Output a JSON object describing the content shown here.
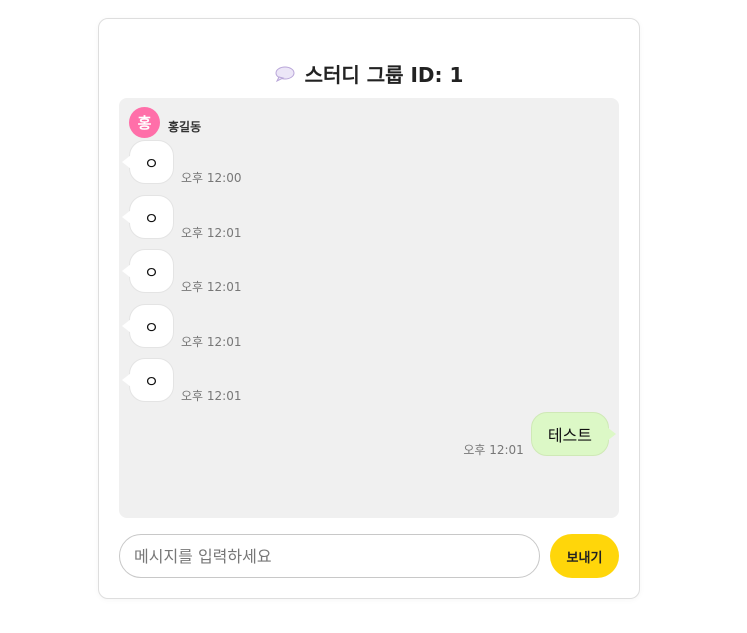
{
  "header": {
    "title": "스터디 그룹 ID: 1",
    "icon": "speech-bubble-icon"
  },
  "sender": {
    "avatar_initial": "홍",
    "name": "홍길동",
    "avatar_color": "#ff6fa9"
  },
  "messages": [
    {
      "text": "ㅇ",
      "time": "오후 12:00"
    },
    {
      "text": "ㅇ",
      "time": "오후 12:01"
    },
    {
      "text": "ㅇ",
      "time": "오후 12:01"
    },
    {
      "text": "ㅇ",
      "time": "오후 12:01"
    },
    {
      "text": "ㅇ",
      "time": "오후 12:01"
    }
  ],
  "my_message": {
    "text": "테스트",
    "time": "오후 12:01",
    "bubble_color": "#dcf8c6"
  },
  "composer": {
    "placeholder": "메시지를 입력하세요",
    "value": "",
    "send_label": "보내기",
    "send_color": "#ffd60a"
  }
}
